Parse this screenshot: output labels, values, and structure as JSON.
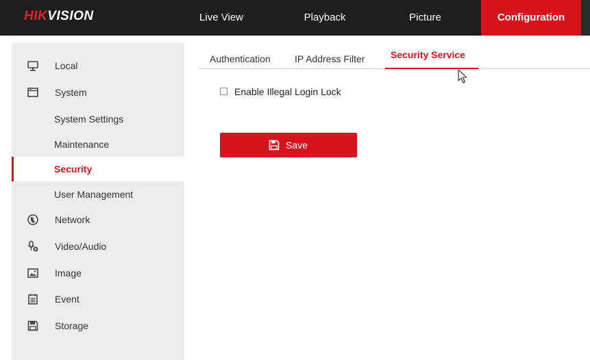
{
  "brand": {
    "logo_red": "HIK",
    "logo_white": "VISION"
  },
  "topnav": {
    "items": [
      {
        "label": "Live View"
      },
      {
        "label": "Playback"
      },
      {
        "label": "Picture"
      },
      {
        "label": "Configuration",
        "active": true
      }
    ]
  },
  "sidebar": {
    "items": [
      {
        "label": "Local",
        "icon": "monitor-icon"
      },
      {
        "label": "System",
        "icon": "window-icon"
      },
      {
        "label": "System Settings",
        "sub": true
      },
      {
        "label": "Maintenance",
        "sub": true
      },
      {
        "label": "Security",
        "sub": true,
        "selected": true
      },
      {
        "label": "User Management",
        "sub": true
      },
      {
        "label": "Network",
        "icon": "globe-icon"
      },
      {
        "label": "Video/Audio",
        "icon": "microphone-camera-icon"
      },
      {
        "label": "Image",
        "icon": "image-icon"
      },
      {
        "label": "Event",
        "icon": "calendar-icon"
      },
      {
        "label": "Storage",
        "icon": "floppy-icon"
      }
    ]
  },
  "tabs": [
    {
      "label": "Authentication"
    },
    {
      "label": "IP Address Filter"
    },
    {
      "label": "Security Service",
      "active": true
    }
  ],
  "form": {
    "illegal_login_lock": {
      "label": "Enable Illegal Login Lock",
      "checked": false
    }
  },
  "actions": {
    "save_label": "Save",
    "save_icon": "floppy-icon"
  },
  "colors": {
    "accent": "#d7141c",
    "topbar": "#1e1e1e",
    "sidebar": "#ededed"
  }
}
